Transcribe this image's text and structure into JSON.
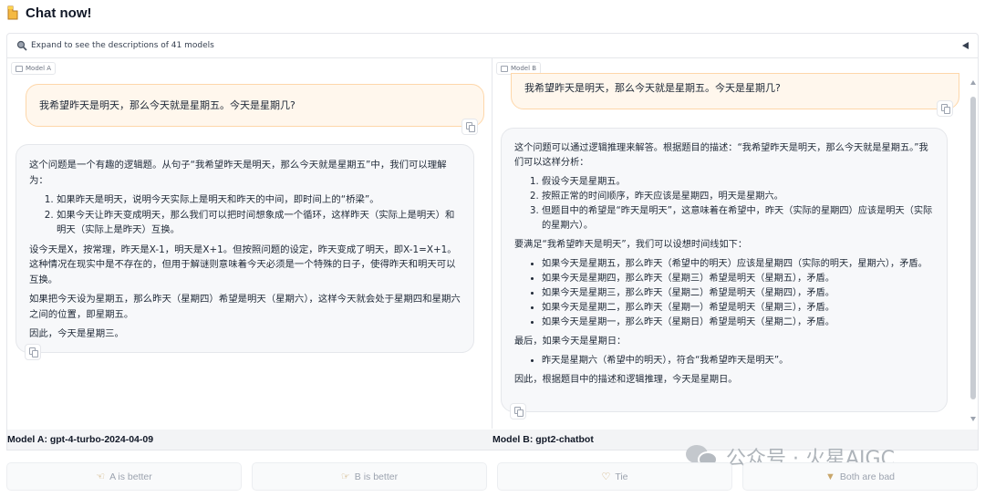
{
  "header": {
    "title": "Chat now!",
    "icon": "pointing-hand-icon"
  },
  "expand_bar": {
    "label": "Expand to see the descriptions of 41 models",
    "icon": "magnifier-icon"
  },
  "model_a": {
    "tab_label": "Model A",
    "user_message": "我希望昨天是明天，那么今天就是星期五。今天是星期几?",
    "reply": {
      "p1": "这个问题是一个有趣的逻辑题。从句子“我希望昨天是明天，那么今天就是星期五”中，我们可以理解为：",
      "list": [
        "如果昨天是明天，说明今天实际上是明天和昨天的中间，即时间上的“桥梁”。",
        "如果今天让昨天变成明天，那么我们可以把时间想象成一个循环，这样昨天（实际上是明天）和明天（实际上是昨天）互换。"
      ],
      "p2": "设今天是X，按常理，昨天是X-1，明天是X+1。但按照问题的设定，昨天变成了明天，即X-1=X+1。这种情况在现实中是不存在的，但用于解谜则意味着今天必须是一个特殊的日子，使得昨天和明天可以互换。",
      "p3": "如果把今天设为星期五，那么昨天（星期四）希望是明天（星期六），这样今天就会处于星期四和星期六之间的位置，即星期五。",
      "p4": "因此，今天是星期三。"
    },
    "name_label": "Model A: gpt-4-turbo-2024-04-09"
  },
  "model_b": {
    "tab_label": "Model B",
    "user_message": "我希望昨天是明天，那么今天就是星期五。今天是星期几?",
    "reply": {
      "p1": "这个问题可以通过逻辑推理来解答。根据题目的描述：“我希望昨天是明天，那么今天就是星期五。”我们可以这样分析：",
      "list1": [
        "假设今天是星期五。",
        "按照正常的时间顺序，昨天应该是星期四，明天是星期六。",
        "但题目中的希望是“昨天是明天”，这意味着在希望中，昨天（实际的星期四）应该是明天（实际的星期六）。"
      ],
      "p2": "要满足“我希望昨天是明天”，我们可以设想时间线如下：",
      "list2": [
        "如果今天是星期五，那么昨天（希望中的明天）应该是星期四（实际的明天，星期六），矛盾。",
        "如果今天是星期四，那么昨天（星期三）希望是明天（星期五），矛盾。",
        "如果今天是星期三，那么昨天（星期二）希望是明天（星期四），矛盾。",
        "如果今天是星期二，那么昨天（星期一）希望是明天（星期三），矛盾。",
        "如果今天是星期一，那么昨天（星期日）希望是明天（星期二），矛盾。"
      ],
      "p3": "最后，如果今天是星期日：",
      "list3": [
        "昨天是星期六（希望中的明天），符合“我希望昨天是明天”。"
      ],
      "p4": "因此，根据题目中的描述和逻辑推理，今天是星期日。"
    },
    "name_label": "Model B: gpt2-chatbot"
  },
  "vote_buttons": [
    {
      "label": "A is better",
      "icon": "hand-left-icon"
    },
    {
      "label": "B is better",
      "icon": "hand-right-icon"
    },
    {
      "label": "Tie",
      "icon": "heart-icon"
    },
    {
      "label": "Both are bad",
      "icon": "thumbs-down-icon"
    }
  ],
  "watermark": {
    "text": "公众号 · 火星AIGC",
    "icon": "wechat-icon"
  }
}
